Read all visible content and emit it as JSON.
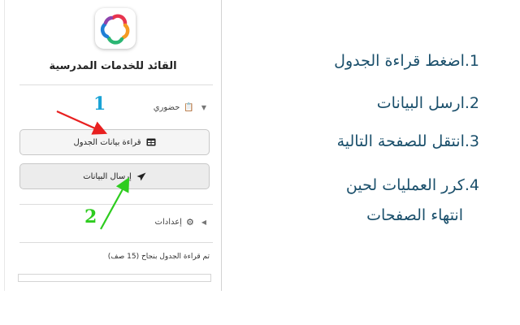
{
  "app": {
    "title": "القائد للخدمات المدرسية"
  },
  "attendance_section": {
    "label": "حضوري",
    "icon": "clipboard-icon",
    "state": "expanded"
  },
  "buttons": {
    "read_table": {
      "label": "قراءة بيانات الجدول",
      "icon": "table-icon"
    },
    "send_data": {
      "label": "إرسال البيانات",
      "icon": "send-icon"
    }
  },
  "settings_section": {
    "label": "إعدادات",
    "icon": "gear-icon",
    "state": "collapsed"
  },
  "status": {
    "message": "تم قراءة الجدول بنجاح (15 صف)"
  },
  "annotations": {
    "callout_1": "1",
    "callout_2": "2",
    "colors": {
      "callout_1": "#e82020",
      "callout_2": "#2ecc1f",
      "number_1": "#1aa3d6"
    }
  },
  "steps": [
    "1.اضغط قراءة الجدول",
    "2.ارسل البيانات",
    "3.انتقل للصفحة التالية",
    "4.كرر العمليات لحين",
    "انتهاء الصفحات"
  ],
  "colors": {
    "step_text": "#1a4f6b"
  }
}
